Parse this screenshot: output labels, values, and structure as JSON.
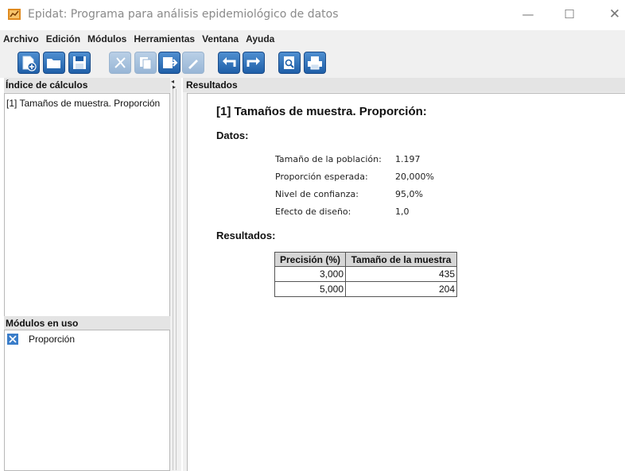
{
  "window": {
    "title": "Epidat: Programa para análisis epidemiológico de datos",
    "minimize": "—",
    "maximize": "☐",
    "close": "✕"
  },
  "menu": [
    "Archivo",
    "Edición",
    "Módulos",
    "Herramientas",
    "Ventana",
    "Ayuda"
  ],
  "toolbar": {
    "buttons": [
      {
        "icon": "new-icon",
        "enabled": true
      },
      {
        "icon": "open-icon",
        "enabled": true
      },
      {
        "icon": "save-icon",
        "enabled": true
      },
      {
        "icon": "cut-icon",
        "enabled": false
      },
      {
        "icon": "copy-icon",
        "enabled": false
      },
      {
        "icon": "paste-icon",
        "enabled": true
      },
      {
        "icon": "edit-icon",
        "enabled": false
      },
      {
        "icon": "undo-icon",
        "enabled": true
      },
      {
        "icon": "redo-icon",
        "enabled": true
      },
      {
        "icon": "print-preview-icon",
        "enabled": true
      },
      {
        "icon": "print-icon",
        "enabled": true
      }
    ]
  },
  "left": {
    "index_header": "Índice de cálculos",
    "index_items": [
      "[1] Tamaños de muestra. Proporción"
    ],
    "modules_header": "Módulos en uso",
    "modules_items": [
      "Proporción"
    ]
  },
  "results": {
    "header": "Resultados",
    "title": "[1] Tamaños de muestra. Proporción:",
    "data_section": "Datos:",
    "data": [
      {
        "label": "Tamaño de la población:",
        "value": "1.197"
      },
      {
        "label": "Proporción esperada:",
        "value": "20,000%"
      },
      {
        "label": "Nivel de confianza:",
        "value": "95,0%"
      },
      {
        "label": "Efecto de diseño:",
        "value": "1,0"
      }
    ],
    "results_section": "Resultados:",
    "table": {
      "headers": [
        "Precisión (%)",
        "Tamaño de la muestra"
      ],
      "rows": [
        [
          "3,000",
          "435"
        ],
        [
          "5,000",
          "204"
        ]
      ]
    }
  },
  "colors": {
    "toolbar_blue": "#2a6bb5",
    "panel_bg": "#f0f0f0",
    "app_icon": "#e08a1e"
  }
}
